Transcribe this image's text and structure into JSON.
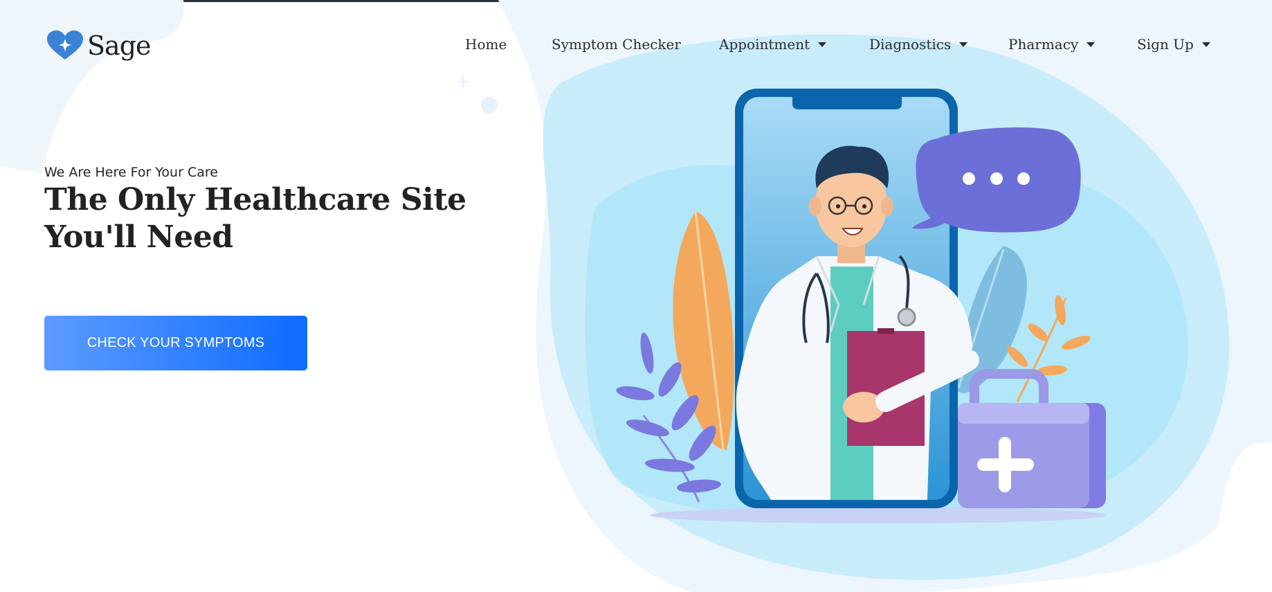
{
  "brand": {
    "name": "Sage"
  },
  "nav": {
    "items": [
      {
        "label": "Home",
        "dropdown": false
      },
      {
        "label": "Symptom Checker",
        "dropdown": false
      },
      {
        "label": "Appointment",
        "dropdown": true
      },
      {
        "label": "Diagnostics",
        "dropdown": true
      },
      {
        "label": "Pharmacy",
        "dropdown": true
      },
      {
        "label": "Sign Up",
        "dropdown": true
      }
    ]
  },
  "hero": {
    "eyebrow": "We Are Here For Your Care",
    "title": "The Only Healthcare Site You'll Need",
    "cta_label": "CHECK YOUR SYMPTOMS"
  },
  "colors": {
    "accent": "#0d6bff",
    "logo": "#3b82d6",
    "illustration_bg": "#bfe9fb",
    "chat_bubble": "#6c6fd8",
    "clipboard": "#a8356b",
    "kit": "#9b98e6"
  },
  "icons": {
    "logo": "heart-sparkle-icon",
    "dropdown": "caret-down-icon"
  }
}
